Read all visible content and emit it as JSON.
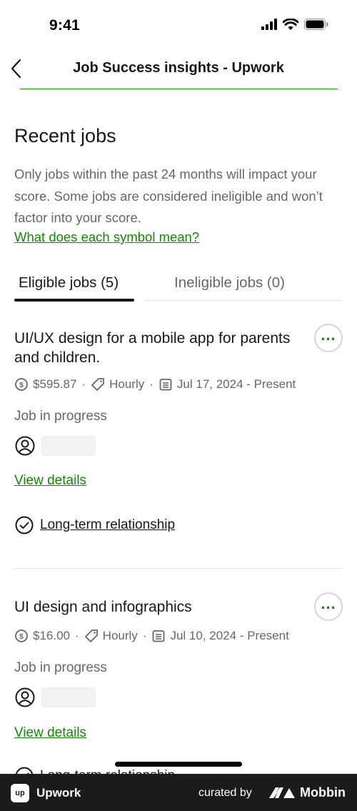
{
  "status_bar": {
    "time": "9:41"
  },
  "nav": {
    "title": "Job Success insights - Upwork"
  },
  "section": {
    "title": "Recent jobs",
    "description": "Only jobs within the past 24 months will impact your score. Some jobs are considered ineligible and won’t factor into your score.",
    "symbol_link": "What does each symbol mean?"
  },
  "tabs": [
    {
      "label": "Eligible jobs (5)",
      "active": true
    },
    {
      "label": "Ineligible jobs (0)",
      "active": false
    }
  ],
  "jobs": [
    {
      "title": "UI/UX design for a mobile app for parents and children.",
      "amount": "$595.87",
      "type": "Hourly",
      "dates": "Jul 17, 2024 - Present",
      "status": "Job in progress",
      "view_details": "View details",
      "badge": "Long-term relationship"
    },
    {
      "title": "UI design and infographics",
      "amount": "$16.00",
      "type": "Hourly",
      "dates": "Jul 10, 2024 - Present",
      "status": "Job in progress",
      "view_details": "View details",
      "badge": "Long-term relationship"
    }
  ],
  "footer": {
    "logo_text": "up",
    "brand": "Upwork",
    "curated_by": "curated by",
    "mobbin": "Mobbin"
  },
  "colors": {
    "accent": "#108a00",
    "text": "#181818",
    "muted": "#676767",
    "footer_bg": "#1b1b1b"
  }
}
